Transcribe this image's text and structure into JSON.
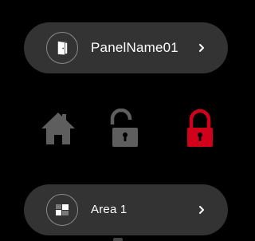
{
  "panel": {
    "label": "PanelName01",
    "icon": "panel-door-icon"
  },
  "modes": [
    {
      "name": "home",
      "icon": "home-icon",
      "color": "#5e5e5e",
      "active": false
    },
    {
      "name": "disarm",
      "icon": "unlocked-padlock-icon",
      "color": "#5e5e5e",
      "active": false
    },
    {
      "name": "arm",
      "icon": "locked-padlock-icon",
      "color": "#d0021b",
      "active": true
    }
  ],
  "area": {
    "label": "Area 1",
    "icon": "area-blocks-icon"
  },
  "colors": {
    "background": "#000000",
    "pill": "#333333",
    "inactive_icon": "#5e5e5e",
    "active_icon": "#d0021b",
    "text": "#ffffff"
  }
}
